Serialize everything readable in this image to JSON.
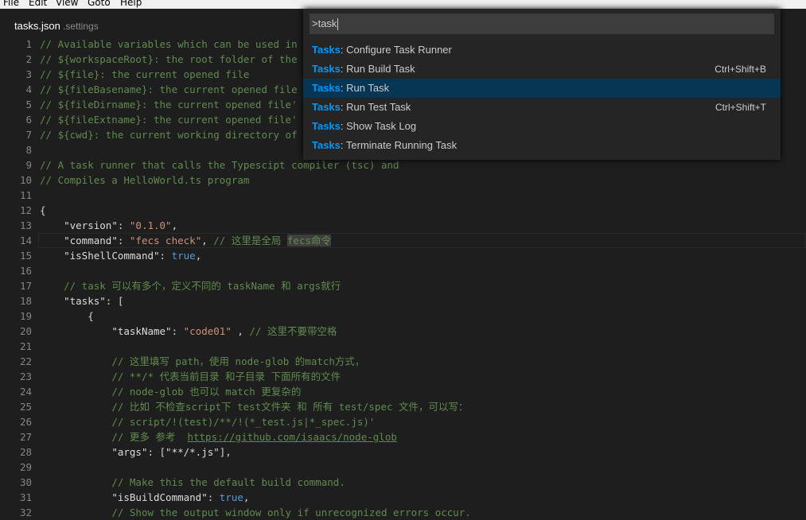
{
  "menubar": {
    "items": [
      "File",
      "Edit",
      "View",
      "Goto",
      "Help"
    ]
  },
  "tab": {
    "title": "tasks.json",
    "description": ".settings"
  },
  "palette": {
    "input_value": ">task",
    "highlight": "Tasks",
    "items": [
      {
        "label": ": Configure Task Runner",
        "keybinding": ""
      },
      {
        "label": ": Run Build Task",
        "keybinding": "Ctrl+Shift+B"
      },
      {
        "label": ": Run Task",
        "keybinding": "",
        "selected": true
      },
      {
        "label": ": Run Test Task",
        "keybinding": "Ctrl+Shift+T"
      },
      {
        "label": ": Show Task Log",
        "keybinding": ""
      },
      {
        "label": ": Terminate Running Task",
        "keybinding": ""
      }
    ]
  },
  "editor": {
    "current_line": 14,
    "lines": [
      {
        "n": "1",
        "t": [
          [
            "c",
            "// Available variables which can be used in"
          ]
        ]
      },
      {
        "n": "2",
        "t": [
          [
            "c",
            "// ${workspaceRoot}: the root folder of the"
          ]
        ]
      },
      {
        "n": "3",
        "t": [
          [
            "c",
            "// ${file}: the current opened file"
          ]
        ]
      },
      {
        "n": "4",
        "t": [
          [
            "c",
            "// ${fileBasename}: the current opened file"
          ]
        ]
      },
      {
        "n": "5",
        "t": [
          [
            "c",
            "// ${fileDirname}: the current opened file'"
          ]
        ]
      },
      {
        "n": "6",
        "t": [
          [
            "c",
            "// ${fileExtname}: the current opened file'"
          ]
        ]
      },
      {
        "n": "7",
        "t": [
          [
            "c",
            "// ${cwd}: the current working directory of"
          ]
        ]
      },
      {
        "n": "8",
        "t": []
      },
      {
        "n": "9",
        "t": [
          [
            "c",
            "// A task runner that calls the Typescipt compiler (tsc) and"
          ]
        ]
      },
      {
        "n": "10",
        "t": [
          [
            "c",
            "// Compiles a HelloWorld.ts program"
          ]
        ]
      },
      {
        "n": "11",
        "t": []
      },
      {
        "n": "12",
        "t": [
          [
            "p",
            "{"
          ]
        ]
      },
      {
        "n": "13",
        "t": [
          [
            "p",
            "    "
          ],
          [
            "k",
            "\"version\""
          ],
          [
            "p",
            ": "
          ],
          [
            "s",
            "\"0.1.0\""
          ],
          [
            "p",
            ","
          ]
        ]
      },
      {
        "n": "14",
        "t": [
          [
            "p",
            "    "
          ],
          [
            "k",
            "\"command\""
          ],
          [
            "p",
            ": "
          ],
          [
            "s",
            "\"fecs check\""
          ],
          [
            "p",
            ", "
          ],
          [
            "c",
            "// 这里是全局 "
          ],
          [
            "h",
            "fecs命令"
          ]
        ]
      },
      {
        "n": "15",
        "t": [
          [
            "p",
            "    "
          ],
          [
            "k",
            "\"isShellCommand\""
          ],
          [
            "p",
            ": "
          ],
          [
            "b",
            "true"
          ],
          [
            "p",
            ","
          ]
        ]
      },
      {
        "n": "16",
        "t": []
      },
      {
        "n": "17",
        "t": [
          [
            "p",
            "    "
          ],
          [
            "c",
            "// task 可以有多个，定义不同的 taskName 和 args就行"
          ]
        ]
      },
      {
        "n": "18",
        "t": [
          [
            "p",
            "    "
          ],
          [
            "k",
            "\"tasks\""
          ],
          [
            "p",
            ": ["
          ]
        ]
      },
      {
        "n": "19",
        "t": [
          [
            "p",
            "        {"
          ]
        ]
      },
      {
        "n": "20",
        "t": [
          [
            "p",
            "            "
          ],
          [
            "k",
            "\"taskName\""
          ],
          [
            "p",
            ": "
          ],
          [
            "s",
            "\"code01\""
          ],
          [
            "p",
            " , "
          ],
          [
            "c",
            "// 这里不要带空格"
          ]
        ]
      },
      {
        "n": "21",
        "t": []
      },
      {
        "n": "22",
        "t": [
          [
            "p",
            "            "
          ],
          [
            "c",
            "// 这里填写 path，使用 node-glob 的match方式，"
          ]
        ]
      },
      {
        "n": "23",
        "t": [
          [
            "p",
            "            "
          ],
          [
            "c",
            "// **/* 代表当前目录 和子目录 下面所有的文件"
          ]
        ]
      },
      {
        "n": "24",
        "t": [
          [
            "p",
            "            "
          ],
          [
            "c",
            "// node-glob 也可以 match 更复杂的"
          ]
        ]
      },
      {
        "n": "25",
        "t": [
          [
            "p",
            "            "
          ],
          [
            "c",
            "// 比如 不检查script下 test文件夹 和 所有 test/spec 文件，可以写："
          ]
        ]
      },
      {
        "n": "26",
        "t": [
          [
            "p",
            "            "
          ],
          [
            "c",
            "// script/!(test)/**/!(*_test.js|*_spec.js)'"
          ]
        ]
      },
      {
        "n": "27",
        "t": [
          [
            "p",
            "            "
          ],
          [
            "c",
            "// 更多 参考  "
          ],
          [
            "u",
            "https://github.com/isaacs/node-glob"
          ]
        ]
      },
      {
        "n": "28",
        "t": [
          [
            "p",
            "            "
          ],
          [
            "k",
            "\"args\""
          ],
          [
            "p",
            ": ["
          ],
          [
            "k",
            "\"**/*.js\""
          ],
          [
            "p",
            "],"
          ]
        ]
      },
      {
        "n": "29",
        "t": []
      },
      {
        "n": "30",
        "t": [
          [
            "p",
            "            "
          ],
          [
            "c",
            "// Make this the default build command."
          ]
        ]
      },
      {
        "n": "31",
        "t": [
          [
            "p",
            "            "
          ],
          [
            "k",
            "\"isBuildCommand\""
          ],
          [
            "p",
            ": "
          ],
          [
            "b",
            "true"
          ],
          [
            "p",
            ","
          ]
        ]
      },
      {
        "n": "32",
        "t": [
          [
            "p",
            "            "
          ],
          [
            "c",
            "// Show the output window only if unrecognized errors occur."
          ]
        ]
      }
    ]
  },
  "colors": {
    "background": "#1e1e1e",
    "comment": "#608b4e",
    "string": "#ce9178",
    "keyword": "#569cd6",
    "match_highlight": "#0097fb",
    "selected_item": "#073655"
  }
}
